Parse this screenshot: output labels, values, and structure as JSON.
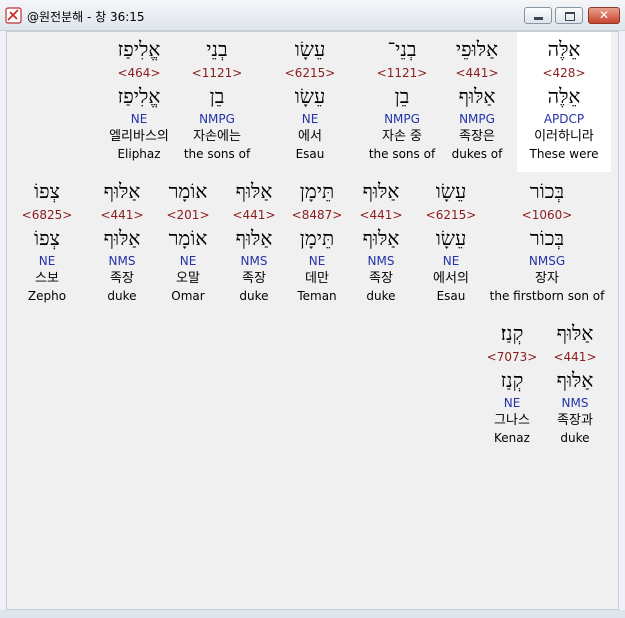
{
  "window": {
    "title": "@원전분해 - 창 36:15",
    "close_glyph": "✕"
  },
  "rows": [
    [
      {
        "heb": "אֱלִיפַז",
        "strong": "<464>",
        "heb2": "אֱלִיפַז",
        "parse": "NE",
        "kor": "엘리바스의",
        "eng": "Eliphaz"
      },
      {
        "heb": "בְנֵי",
        "strong": "<1121>",
        "heb2": "בֵן",
        "parse": "NMPG",
        "kor": "자손에는",
        "eng": "the sons of"
      },
      {
        "heb": "עֵשָׂו",
        "strong": "<6215>",
        "heb2": "עֵשָׂו",
        "parse": "NE",
        "kor": "에서",
        "eng": "Esau"
      },
      {
        "heb": "בְנֵי־",
        "strong": "<1121>",
        "heb2": "בֵן",
        "parse": "NMPG",
        "kor": "자손 중",
        "eng": "the sons of"
      },
      {
        "heb": "אַלּוּפֵי",
        "strong": "<441>",
        "heb2": "אַלּוּף",
        "parse": "NMPG",
        "kor": "족장은",
        "eng": "dukes of"
      },
      {
        "heb": "אֵלֶּה",
        "strong": "<428>",
        "heb2": "אֵלֶּה",
        "parse": "APDCP",
        "kor": "이러하니라",
        "eng": "These were"
      }
    ],
    [
      {
        "heb": "צְפוֹ",
        "strong": "<6825>",
        "heb2": "צְפוֹ",
        "parse": "NE",
        "kor": "스보",
        "eng": "Zepho"
      },
      {
        "heb": "אַלּוּף",
        "strong": "<441>",
        "heb2": "אַלּוּף",
        "parse": "NMS",
        "kor": "족장",
        "eng": "duke"
      },
      {
        "heb": "אוֹמָר",
        "strong": "<201>",
        "heb2": "אוֹמָר",
        "parse": "NE",
        "kor": "오말",
        "eng": "Omar"
      },
      {
        "heb": "אַלּוּף",
        "strong": "<441>",
        "heb2": "אַלּוּף",
        "parse": "NMS",
        "kor": "족장",
        "eng": "duke"
      },
      {
        "heb": "תֵּימָן",
        "strong": "<8487>",
        "heb2": "תֵּימָן",
        "parse": "NE",
        "kor": "데만",
        "eng": "Teman"
      },
      {
        "heb": "אַלּוּף",
        "strong": "<441>",
        "heb2": "אַלּוּף",
        "parse": "NMS",
        "kor": "족장",
        "eng": "duke"
      },
      {
        "heb": "עֵשָׂו",
        "strong": "<6215>",
        "heb2": "עֵשָׂו",
        "parse": "NE",
        "kor": "에서의",
        "eng": "Esau"
      },
      {
        "heb": "בְּכוֹר",
        "strong": "<1060>",
        "heb2": "בְּכוֹר",
        "parse": "NMSG",
        "kor": "장자",
        "eng": "the firstborn son of"
      }
    ],
    [
      {
        "heb": "קְנַז׃",
        "strong": "<7073>",
        "heb2": "קְנַז",
        "parse": "NE",
        "kor": "그나스",
        "eng": "Kenaz"
      },
      {
        "heb": "אַלּוּף",
        "strong": "<441>",
        "heb2": "אַלּוּף",
        "parse": "NMS",
        "kor": "족장과",
        "eng": "duke"
      }
    ]
  ]
}
